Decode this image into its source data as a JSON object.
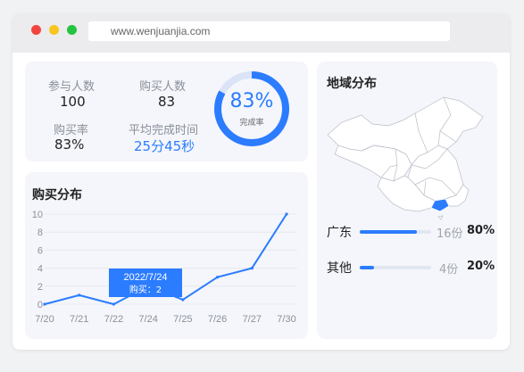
{
  "browser": {
    "url": "www.wenjuanjia.com"
  },
  "stats": {
    "participants_label": "参与人数",
    "participants_value": "100",
    "buyers_label": "购买人数",
    "buyers_value": "83",
    "purchase_rate_label": "购买率",
    "purchase_rate_value": "83%",
    "avg_time_label": "平均完成时间",
    "avg_time_value": "25分45秒",
    "completion_pct": "83%",
    "completion_fraction": 0.83,
    "completion_label": "完成率"
  },
  "purchase": {
    "title": "购买分布",
    "tooltip": {
      "date": "2022/7/24",
      "text": "购买：2"
    }
  },
  "chart_data": {
    "type": "line",
    "title": "购买分布",
    "categories": [
      "7/20",
      "7/21",
      "7/22",
      "7/24",
      "7/25",
      "7/26",
      "7/27",
      "7/30"
    ],
    "values": [
      0,
      1,
      0,
      2,
      0.5,
      3,
      4,
      10
    ],
    "yticks": [
      "0",
      "2",
      "4",
      "6",
      "8",
      "10"
    ],
    "ylim": [
      0,
      10
    ],
    "color": "#2b7cff"
  },
  "region": {
    "title": "地域分布",
    "items": [
      {
        "name": "广东",
        "count": "16份",
        "percent": "80%",
        "fraction": 0.8
      },
      {
        "name": "其他",
        "count": "4份",
        "percent": "20%",
        "fraction": 0.2
      }
    ]
  },
  "colors": {
    "accent": "#2b7cff",
    "card": "#f4f6fb"
  }
}
